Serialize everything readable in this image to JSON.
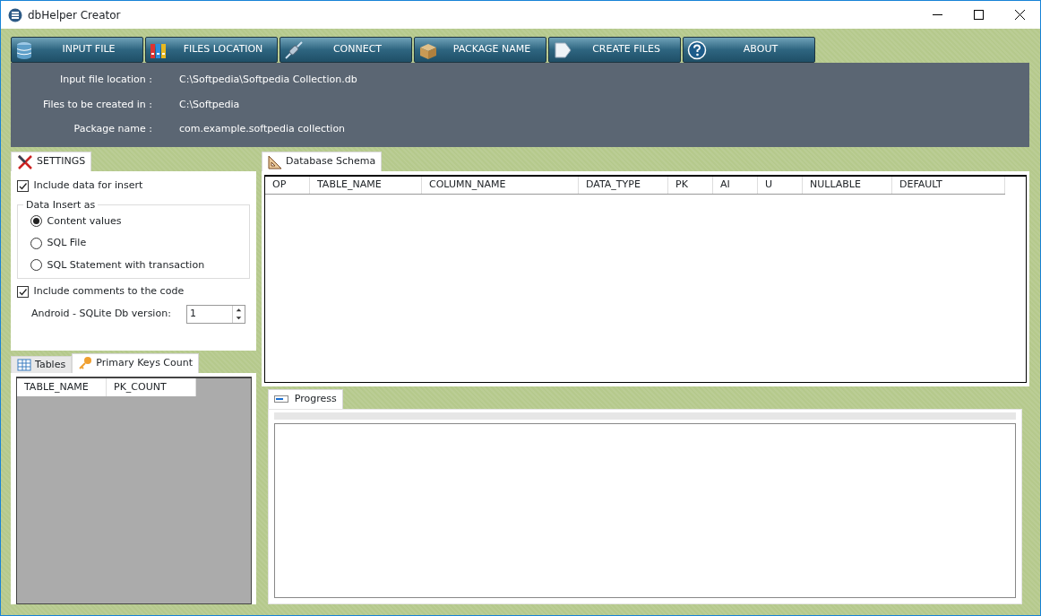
{
  "window": {
    "title": "dbHelper Creator"
  },
  "toolbar": [
    {
      "label": "INPUT FILE",
      "kind": "database"
    },
    {
      "label": "FILES LOCATION",
      "kind": "binders"
    },
    {
      "label": "CONNECT",
      "kind": "plug"
    },
    {
      "label": "PACKAGE NAME",
      "kind": "box"
    },
    {
      "label": "CREATE FILES",
      "kind": "document"
    },
    {
      "label": "ABOUT",
      "kind": "help"
    }
  ],
  "info": [
    {
      "label": "Input file location :",
      "value": "C:\\Softpedia\\Softpedia Collection.db"
    },
    {
      "label": "Files to be created in :",
      "value": "C:\\Softpedia"
    },
    {
      "label": "Package name :",
      "value": "com.example.softpedia collection"
    }
  ],
  "settings": {
    "tab": "SETTINGS",
    "include_data": {
      "label": "Include data for insert",
      "checked": true
    },
    "group_title": "Data Insert as",
    "options": [
      {
        "label": "Content values",
        "selected": true
      },
      {
        "label": "SQL File",
        "selected": false
      },
      {
        "label": "SQL Statement with transaction",
        "selected": false
      }
    ],
    "include_comments": {
      "label": "Include comments to the code",
      "checked": true
    },
    "version_label": "Android - SQLite Db version:",
    "version": "1"
  },
  "lower_tabs": [
    {
      "label": "Tables",
      "kind": "grid",
      "selected": false
    },
    {
      "label": "Primary Keys Count",
      "kind": "key",
      "selected": true
    }
  ],
  "pk_table": {
    "columns": [
      "TABLE_NAME",
      "PK_COUNT"
    ]
  },
  "schema": {
    "tab": "Database Schema",
    "columns": [
      "OP",
      "TABLE_NAME",
      "COLUMN_NAME",
      "DATA_TYPE",
      "PK",
      "AI",
      "U",
      "NULLABLE",
      "DEFAULT"
    ]
  },
  "progress": {
    "tab": "Progress",
    "level": 0
  }
}
